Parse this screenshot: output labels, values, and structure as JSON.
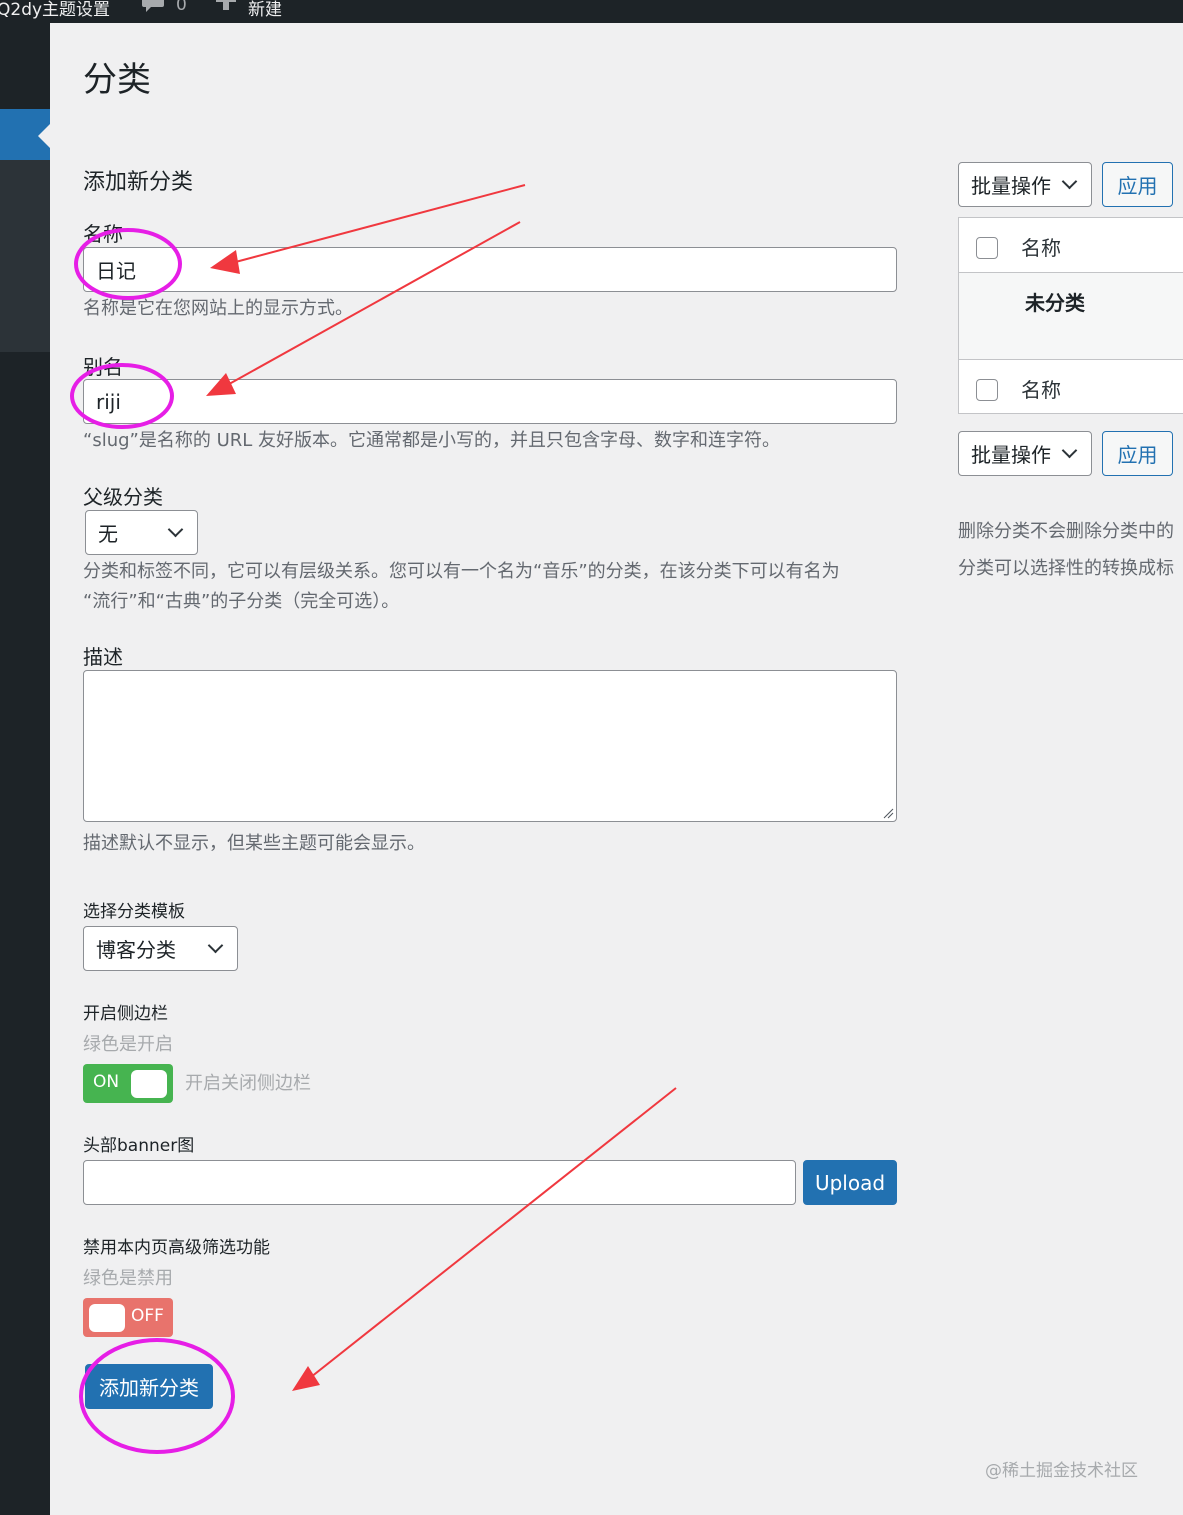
{
  "adminbar": {
    "site_name": "Q2dy主题设置",
    "comments_count": "0",
    "new_label": "新建"
  },
  "page": {
    "title": "分类",
    "form_title": "添加新分类"
  },
  "form": {
    "name": {
      "label": "名称",
      "value": "日记",
      "help": "名称是它在您网站上的显示方式。"
    },
    "slug": {
      "label": "别名",
      "value": "riji",
      "help": "“slug”是名称的 URL 友好版本。它通常都是小写的，并且只包含字母、数字和连字符。"
    },
    "parent": {
      "label": "父级分类",
      "selected": "无",
      "help_line1": "分类和标签不同，它可以有层级关系。您可以有一个名为“音乐”的分类，在该分类下可以有名为",
      "help_line2": "“流行”和“古典”的子分类（完全可选）。"
    },
    "description": {
      "label": "描述",
      "value": "",
      "help": "描述默认不显示，但某些主题可能会显示。"
    },
    "template": {
      "label": "选择分类模板",
      "selected": "博客分类"
    },
    "sidebar_toggle": {
      "label": "开启侧边栏",
      "hint": "绿色是开启",
      "state": "ON",
      "desc": "开启关闭侧边栏",
      "color": "#46b450"
    },
    "banner": {
      "label": "头部banner图",
      "value": "",
      "button": "Upload"
    },
    "filter_toggle": {
      "label": "禁用本内页高级筛选功能",
      "hint": "绿色是禁用",
      "state": "OFF",
      "color": "#e8736c"
    },
    "submit": "添加新分类"
  },
  "list": {
    "bulk_top": "批量操作",
    "apply_top": "应用",
    "header": "名称",
    "rows": [
      {
        "name": "未分类"
      }
    ],
    "footer": "名称",
    "bulk_bottom": "批量操作",
    "apply_bottom": "应用",
    "note_line1": "删除分类不会删除分类中的",
    "note_line2": "分类可以选择性的转换成标"
  },
  "watermark": "@稀土掘金技术社区",
  "annotation_colors": {
    "arrow": "#f0383f",
    "circle": "#e61ee6"
  },
  "colors": {
    "primary": "#2271b1",
    "background": "#f0f0f1",
    "adminbar": "#1d2327"
  }
}
